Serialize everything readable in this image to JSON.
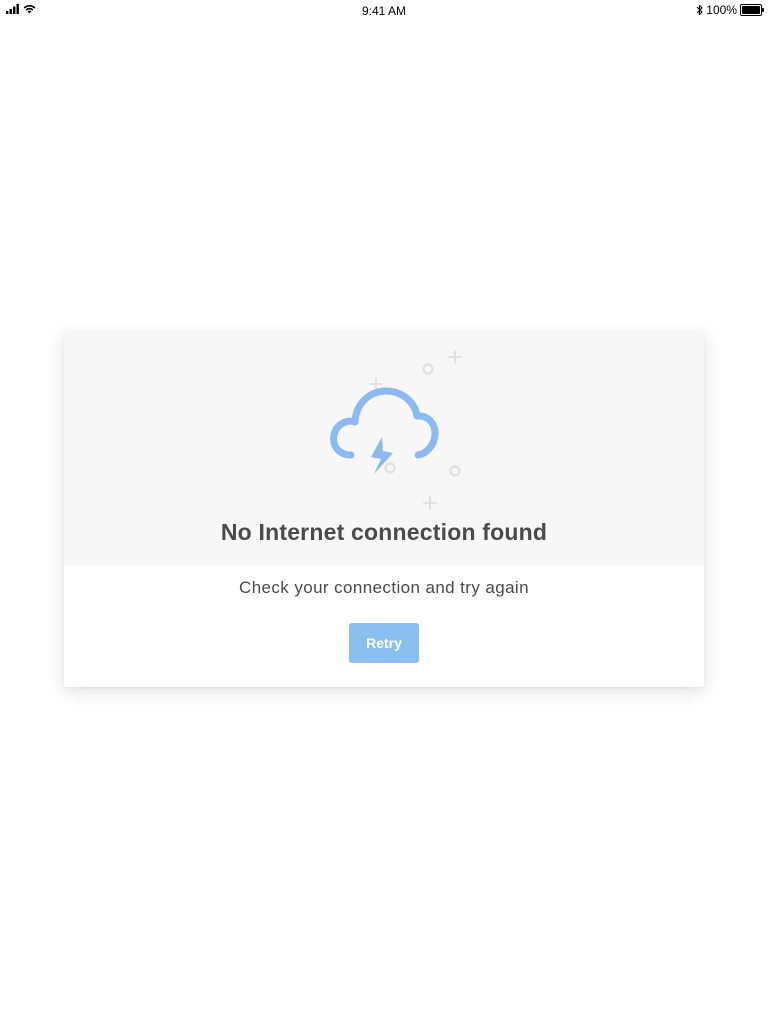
{
  "status_bar": {
    "time": "9:41 AM",
    "battery_percent": "100%",
    "battery_level": 1.0,
    "icons": [
      "signal-icon",
      "wifi-icon",
      "bluetooth-icon",
      "battery-icon"
    ]
  },
  "dialog": {
    "title": "No Internet connection found",
    "message": "Check your connection and try again",
    "retry_label": "Retry",
    "illustration": "cloud-lightning-icon"
  },
  "colors": {
    "accent": "#8bbff0",
    "cloud": "#8bbaf0",
    "text": "#4a4a4a",
    "card_top_bg": "#f7f7f7",
    "decoration": "#e1e1e1"
  }
}
